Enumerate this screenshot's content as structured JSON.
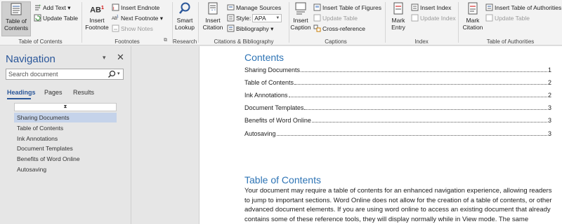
{
  "ribbon": {
    "toc_group": {
      "label": "Table of Contents",
      "toc_button": "Table of\nContents",
      "add_text": "Add Text",
      "update_table": "Update Table"
    },
    "footnotes_group": {
      "label": "Footnotes",
      "insert_footnote": "Insert\nFootnote",
      "insert_endnote": "Insert Endnote",
      "next_footnote": "Next Footnote",
      "show_notes": "Show Notes",
      "footnote_glyph": "AB"
    },
    "research_group": {
      "label": "Research",
      "smart_lookup": "Smart\nLookup"
    },
    "citations_group": {
      "label": "Citations & Bibliography",
      "insert_citation": "Insert\nCitation",
      "manage_sources": "Manage Sources",
      "style_label": "Style:",
      "style_value": "APA",
      "bibliography": "Bibliography"
    },
    "captions_group": {
      "label": "Captions",
      "insert_caption": "Insert\nCaption",
      "insert_table_of_figures": "Insert Table of Figures",
      "update_table": "Update Table",
      "cross_reference": "Cross-reference"
    },
    "index_group": {
      "label": "Index",
      "mark_entry": "Mark\nEntry",
      "insert_index": "Insert Index",
      "update_index": "Update Index"
    },
    "authorities_group": {
      "label": "Table of Authorities",
      "mark_citation": "Mark\nCitation",
      "insert_table_of_authorities": "Insert Table of Authorities",
      "update_table": "Update Table"
    }
  },
  "navigation": {
    "title": "Navigation",
    "search_placeholder": "Search document",
    "tabs": [
      "Headings",
      "Pages",
      "Results"
    ],
    "headings": [
      "Sharing Documents",
      "Table of Contents",
      "Ink Annotations",
      "Document Templates",
      "Benefits of Word Online",
      "Autosaving"
    ]
  },
  "document": {
    "contents_heading": "Contents",
    "toc": [
      {
        "title": "Sharing Documents",
        "page": "1"
      },
      {
        "title": "Table of Contents",
        "page": "2"
      },
      {
        "title": "Ink Annotations",
        "page": "2"
      },
      {
        "title": "Document Templates",
        "page": "3"
      },
      {
        "title": "Benefits of Word Online",
        "page": "3"
      },
      {
        "title": "Autosaving",
        "page": "3"
      }
    ],
    "section_heading": "Table of Contents",
    "paragraph": "Your document may require a table of contents for an enhanced navigation experience, allowing readers to jump to important sections. Word Online does not allow for the creation of a table of contents, or other advanced document elements. If you are using word online to access an existing document that already contains some of these reference tools, they will display normally while in View mode. The same"
  },
  "colors": {
    "accent": "#2b579a",
    "heading": "#2e74b5",
    "selection": "#c5d3ea"
  }
}
